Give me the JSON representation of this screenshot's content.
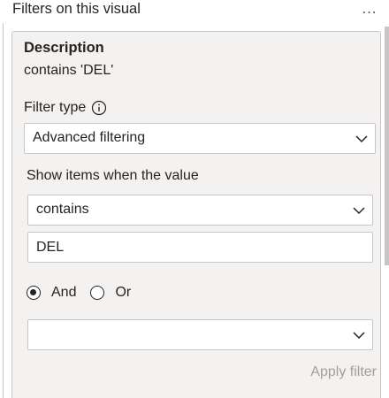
{
  "pane": {
    "title": "Filters on this visual",
    "more_label": "…"
  },
  "card": {
    "field_name": "Description",
    "summary": "contains 'DEL'",
    "filter_type_label": "Filter type",
    "filter_type_value": "Advanced filtering",
    "show_items_label": "Show items when the value",
    "condition1": {
      "operator": "contains",
      "value": "DEL"
    },
    "logic": {
      "and_label": "And",
      "or_label": "Or",
      "selected": "And"
    },
    "condition2": {
      "operator": ""
    },
    "apply_label": "Apply filter"
  },
  "icons": {
    "info": "info-icon",
    "chevron": "chevron-down-icon",
    "more": "more-options-icon"
  },
  "colors": {
    "card_background": "#f3f2f1",
    "border": "#c8c6c4",
    "text": "#252423",
    "disabled_text": "#a19f9d"
  }
}
